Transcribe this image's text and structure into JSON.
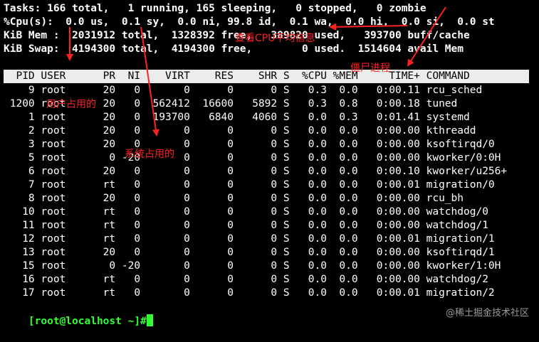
{
  "summary": {
    "tasks": "Tasks: 166 total,   1 running, 165 sleeping,   0 stopped,   0 zombie",
    "cpu": "%Cpu(s):  0.0 us,  0.1 sy,  0.0 ni, 99.8 id,  0.1 wa,  0.0 hi,  0.0 si,  0.0 st",
    "mem": "KiB Mem :  2031912 total,  1328392 free,   389820 used,   393700 buff/cache",
    "swap": "KiB Swap:  4194300 total,  4194300 free,        0 used.  1514604 avail Mem"
  },
  "table": {
    "header": "  PID USER      PR  NI    VIRT    RES    SHR S  %CPU %MEM     TIME+ COMMAND",
    "rows": [
      "    9 root      20   0       0      0      0 S   0.3  0.0   0:00.11 rcu_sched",
      " 1200 root      20   0  562412  16600   5892 S   0.3  0.8   0:00.18 tuned",
      "    1 root      20   0  193700   6840   4060 S   0.0  0.3   0:01.41 systemd",
      "    2 root      20   0       0      0      0 S   0.0  0.0   0:00.00 kthreadd",
      "    3 root      20   0       0      0      0 S   0.0  0.0   0:00.00 ksoftirqd/0",
      "    5 root       0 -20       0      0      0 S   0.0  0.0   0:00.00 kworker/0:0H",
      "    6 root      20   0       0      0      0 S   0.0  0.0   0:00.10 kworker/u256+",
      "    7 root      rt   0       0      0      0 S   0.0  0.0   0:00.01 migration/0",
      "    8 root      20   0       0      0      0 S   0.0  0.0   0:00.00 rcu_bh",
      "   10 root      rt   0       0      0      0 S   0.0  0.0   0:00.00 watchdog/0",
      "   11 root      rt   0       0      0      0 S   0.0  0.0   0:00.00 watchdog/1",
      "   12 root      rt   0       0      0      0 S   0.0  0.0   0:00.01 migration/1",
      "   13 root      20   0       0      0      0 S   0.0  0.0   0:00.00 ksoftirqd/1",
      "   15 root       0 -20       0      0      0 S   0.0  0.0   0:00.00 kworker/1:0H",
      "   16 root      rt   0       0      0      0 S   0.0  0.0   0:00.00 watchdog/2",
      "   17 root      rt   0       0      0      0 S   0.0  0.0   0:00.01 migration/2"
    ]
  },
  "prompt": "[root@localhost ~]#",
  "annotations": {
    "user_usage": "用户占用的",
    "system_usage": "系统占用的",
    "cpu_info": "查看CPU平均信息",
    "zombie": "僵尸进程"
  },
  "watermark": "@稀土掘金技术社区",
  "colors": {
    "background": "#000000",
    "text": "#ffffff",
    "header_bar": "#ececec",
    "prompt": "#33ff33",
    "annotation": "#ff2020"
  }
}
